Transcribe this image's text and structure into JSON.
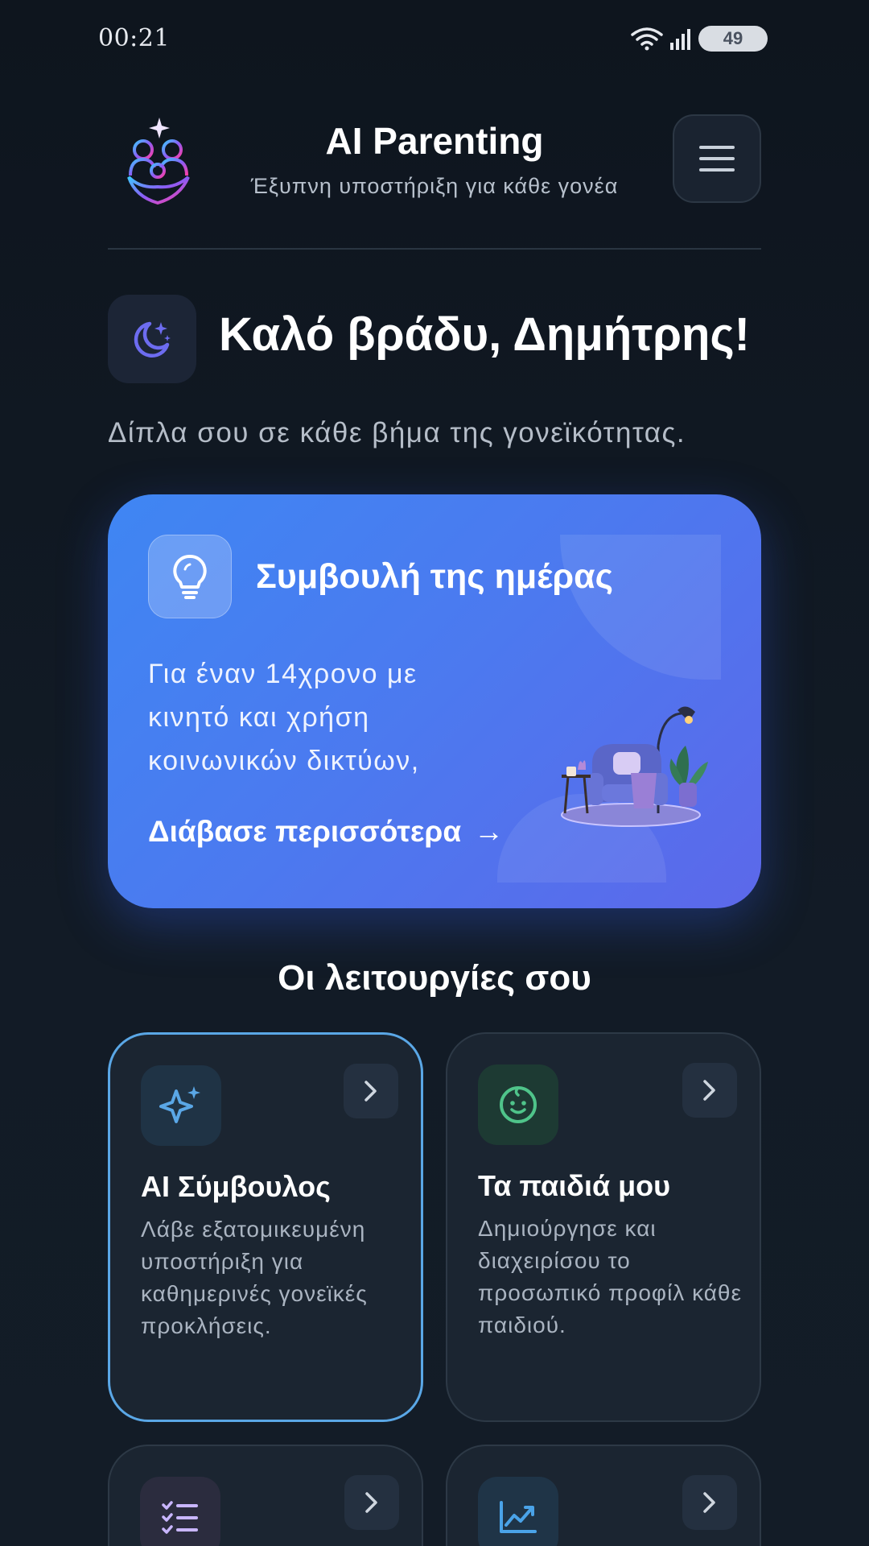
{
  "status_bar": {
    "time": "00:21",
    "battery": "49"
  },
  "header": {
    "title": "AI Parenting",
    "subtitle": "Έξυπνη υποστήριξη για κάθε γονέα"
  },
  "greeting": {
    "text": "Καλό βράδυ, Δημήτρης!",
    "tagline": "Δίπλα σου σε κάθε βήμα της γονεϊκότητας."
  },
  "tip": {
    "title": "Συμβουλή της ημέρας",
    "body": "Για έναν 14χρονο με κινητό και χρήση κοινωνικών δικτύων,",
    "link": "Διάβασε περισσότερα",
    "arrow": "→"
  },
  "features": {
    "title": "Οι λειτουργίες σου",
    "items": [
      {
        "title": "AI Σύμβουλος",
        "description": "Λάβε εξατομικευμένη υποστήριξη για καθημερινές γονεϊκές προκλήσεις.",
        "icon": "sparkles-icon",
        "accent": "#5aa7e6"
      },
      {
        "title": "Τα παιδιά μου",
        "description": "Δημιούργησε και διαχειρίσου το προσωπικό προφίλ κάθε παιδιού.",
        "icon": "baby-face-icon",
        "accent": "#4fc48a"
      },
      {
        "title": "",
        "description": "",
        "icon": "checklist-icon",
        "accent": "#c9b6ff"
      },
      {
        "title": "",
        "description": "",
        "icon": "trending-up-icon",
        "accent": "#4aa3e8"
      }
    ]
  }
}
